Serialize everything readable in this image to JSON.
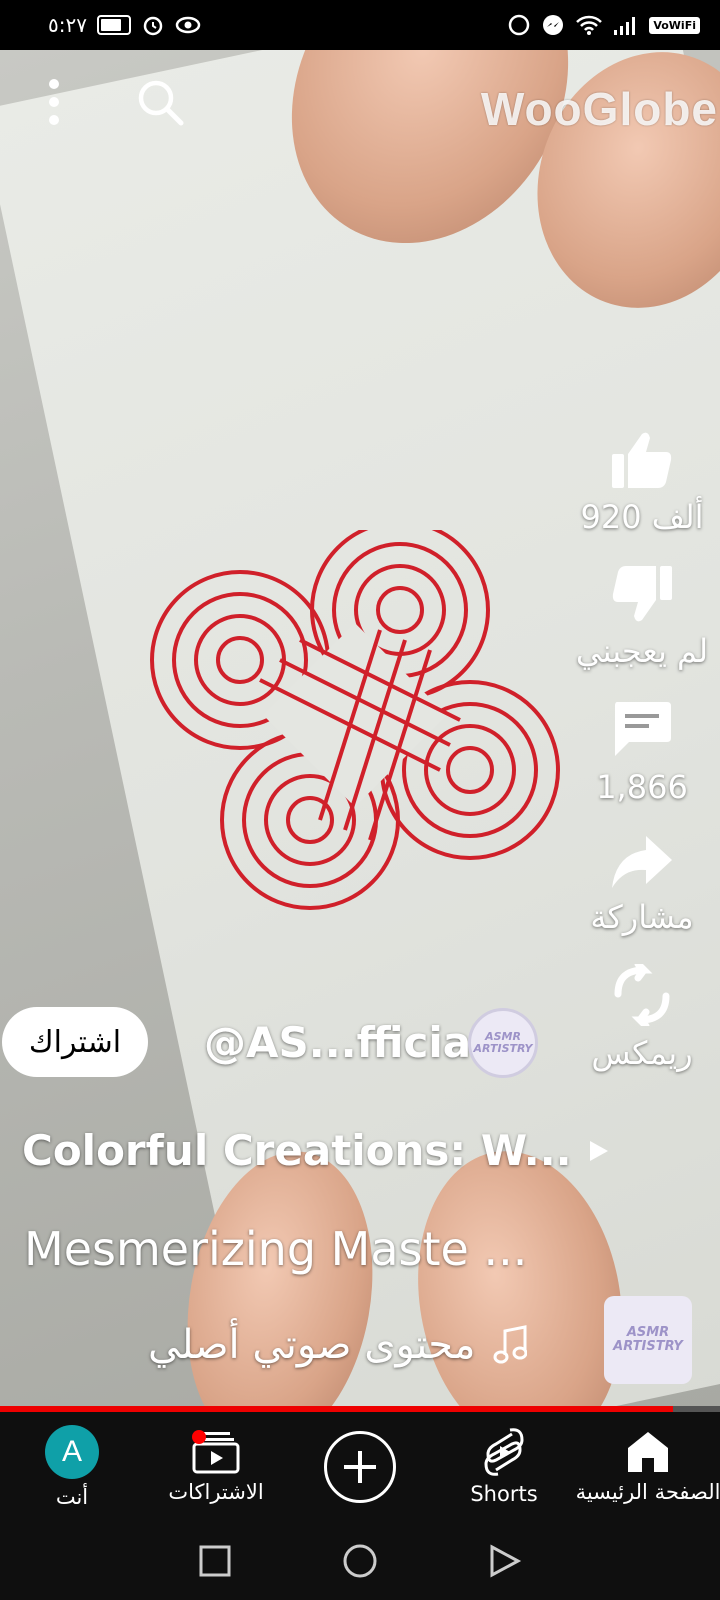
{
  "status_bar": {
    "time": "٥:٢٧",
    "vowifi": "VoWiFi"
  },
  "watermark": "WooGlobe",
  "actions": {
    "like_count": "920 ألف",
    "dislike_label": "لم يعجبني",
    "comment_count": "1,866",
    "share_label": "مشاركة",
    "remix_label": "ريمكس"
  },
  "channel": {
    "subscribe_label": "اشتراك",
    "handle": "@AS...fficial",
    "avatar_text": "ASMR ARTISTRY"
  },
  "playlist_title": "Colorful Creations: W...",
  "video_title": "Mesmerizing Maste ...",
  "audio": {
    "label": "محتوى صوتي أصلي",
    "thumb_text": "ASMR ARTISTRY"
  },
  "progress": 0.935,
  "bottom_nav": {
    "you": "أنت",
    "you_initial": "A",
    "subscriptions": "الاشتراكات",
    "shorts": "Shorts",
    "home": "الصفحة الرئيسية"
  },
  "colors": {
    "accent": "#ff0000",
    "avatar_bg": "#0fa0a8"
  }
}
